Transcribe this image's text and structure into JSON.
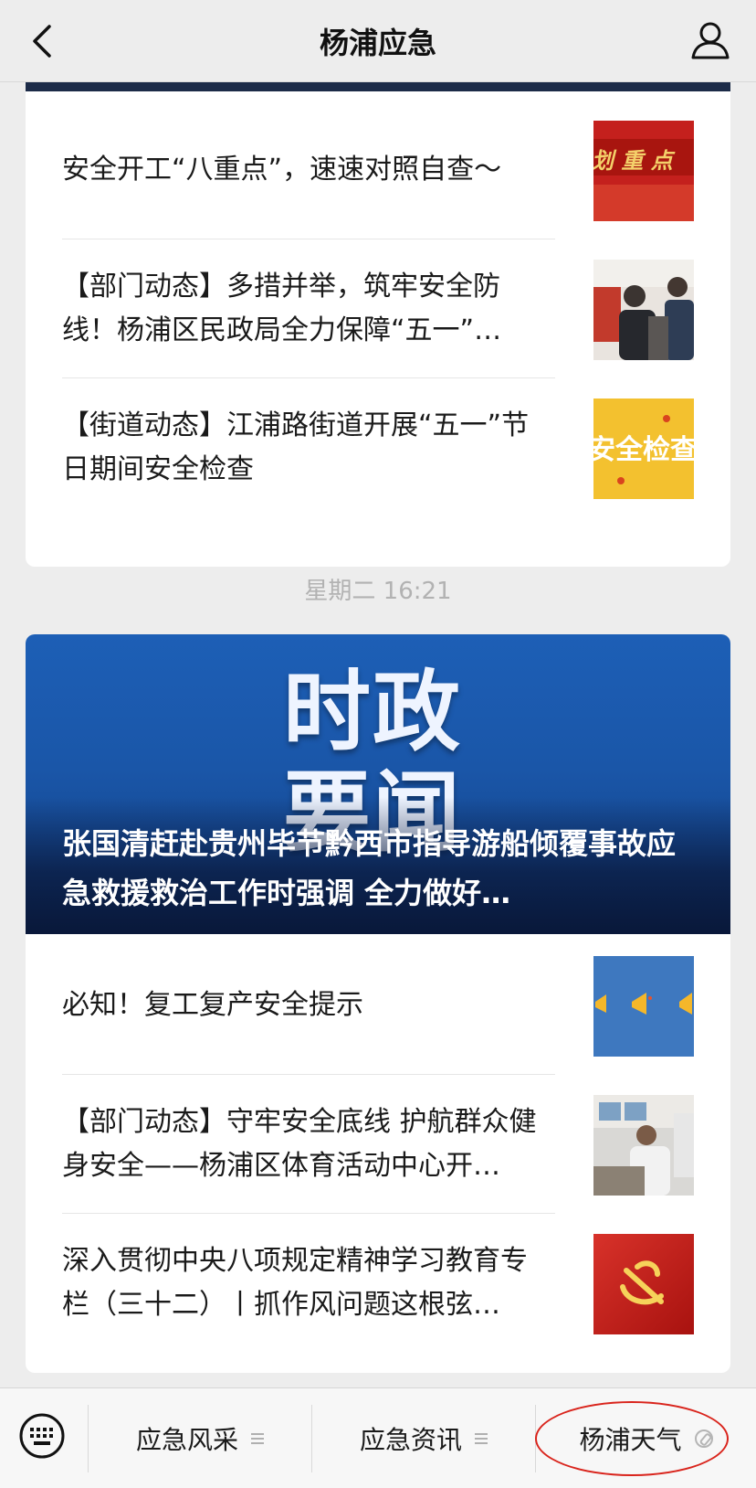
{
  "header": {
    "title": "杨浦应急",
    "back_icon": "chevron-left-icon",
    "profile_icon": "user-icon"
  },
  "group1": {
    "items": [
      {
        "title": "安全开工“八重点”，速速对照自查～",
        "thumb_text": "划 重 点"
      },
      {
        "title": "【部门动态】多措并举，筑牢安全防线！杨浦区民政局全力保障“五一”…"
      },
      {
        "title": "【街道动态】江浦路街道开展“五一”节日期间安全检查",
        "thumb_text": "安全检查"
      }
    ]
  },
  "timestamp": "星期二 16:21",
  "group2": {
    "banner": {
      "big_text_1": "时政",
      "big_text_2": "要闻",
      "headline": "张国清赶赴贵州毕节黔西市指导游船倾覆事故应急救援救治工作时强调 全力做好…"
    },
    "items": [
      {
        "title": "必知！复工复产安全提示"
      },
      {
        "title": "【部门动态】守牢安全底线 护航群众健身安全——杨浦区体育活动中心开…"
      },
      {
        "title": "深入贯彻中央八项规定精神学习教育专栏（三十二）丨抓作风问题这根弦…"
      }
    ]
  },
  "menu": {
    "keyboard_icon": "keyboard-icon",
    "items": [
      {
        "label": "应急风采"
      },
      {
        "label": "应急资讯"
      },
      {
        "label": "杨浦天气"
      }
    ]
  },
  "colors": {
    "accent_ring": "#d9241c",
    "banner_blue": "#1a56a8",
    "timestamp": "#b2b2b2"
  }
}
